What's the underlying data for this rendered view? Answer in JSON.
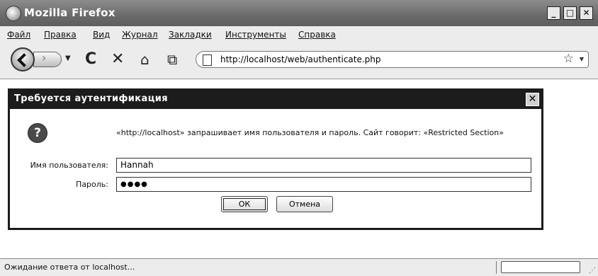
{
  "window": {
    "title": "Mozilla Firefox",
    "controls": {
      "minimize": "_",
      "maximize": "□",
      "close": "✕"
    }
  },
  "menu": [
    "Файл",
    "Правка",
    "Вид",
    "Журнал",
    "Закладки",
    "Инструменты",
    "Справка"
  ],
  "toolbar": {
    "icons": [
      "back-icon",
      "forward-icon",
      "reload-icon",
      "stop-icon",
      "home-icon",
      "screenshot-icon"
    ],
    "reload_glyph": "C",
    "stop_glyph": "✕",
    "home_glyph": "⌂",
    "screenshot_glyph": "⧉",
    "url": "http://localhost/web/authenticate.php",
    "star_glyph": "☆",
    "drop_glyph": "▼"
  },
  "dialog": {
    "title": "Требуется аутентификация",
    "close_glyph": "✕",
    "icon_glyph": "?",
    "message": "«http://localhost» запрашивает имя пользователя и пароль. Сайт говорит: «Restricted Section»",
    "username_label": "Имя пользователя:",
    "username_value": "Hannah",
    "password_label": "Пароль:",
    "password_value": "●●●●",
    "ok_label": "ОК",
    "cancel_label": "Отмена"
  },
  "status": {
    "text": "Ожидание ответа от localhost..."
  }
}
